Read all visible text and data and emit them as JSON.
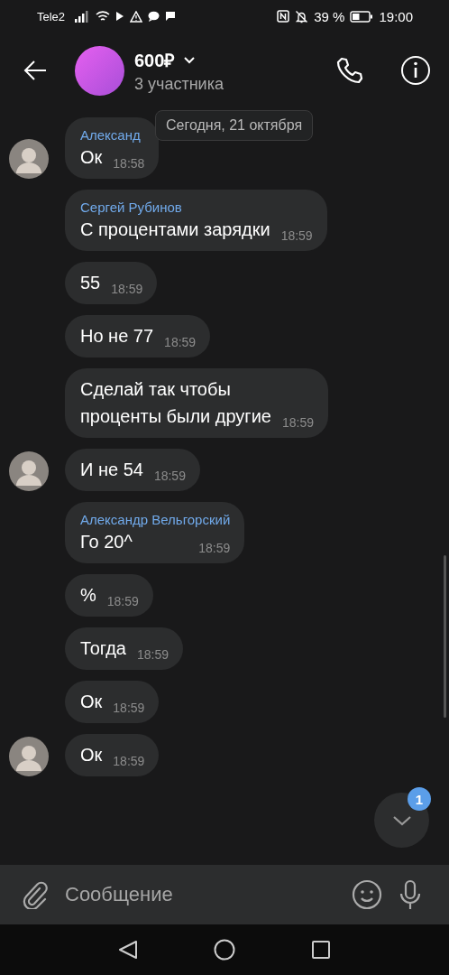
{
  "status_bar": {
    "carrier": "Tele2",
    "battery_percent": "39 %",
    "time": "19:00"
  },
  "header": {
    "title": "600₽",
    "subtitle": "3 участника"
  },
  "date_chip": "Сегодня, 21 октября",
  "messages": [
    {
      "sender": "Александ",
      "text": "Ок",
      "time": "18:58",
      "avatar": true
    },
    {
      "sender": "Сергей Рубинов",
      "text": "С процентами зарядки",
      "time": "18:59",
      "avatar": false
    },
    {
      "text": "55",
      "time": "18:59",
      "avatar": false
    },
    {
      "text": "Но не 77",
      "time": "18:59",
      "avatar": false
    },
    {
      "text": "Сделай так чтобы\nпроценты были другие",
      "time": "18:59",
      "avatar": false
    },
    {
      "text": "И не 54",
      "time": "18:59",
      "avatar": true
    },
    {
      "sender": "Александр Вельгорский",
      "text": "Го 20^",
      "time": "18:59",
      "avatar": false
    },
    {
      "text": "%",
      "time": "18:59",
      "avatar": false
    },
    {
      "text": "Тогда",
      "time": "18:59",
      "avatar": false
    },
    {
      "text": "Ок",
      "time": "18:59",
      "avatar": false
    },
    {
      "text": "Ок",
      "time": "18:59",
      "avatar": true
    }
  ],
  "scroll_button": {
    "badge": "1"
  },
  "composer": {
    "placeholder": "Сообщение"
  }
}
